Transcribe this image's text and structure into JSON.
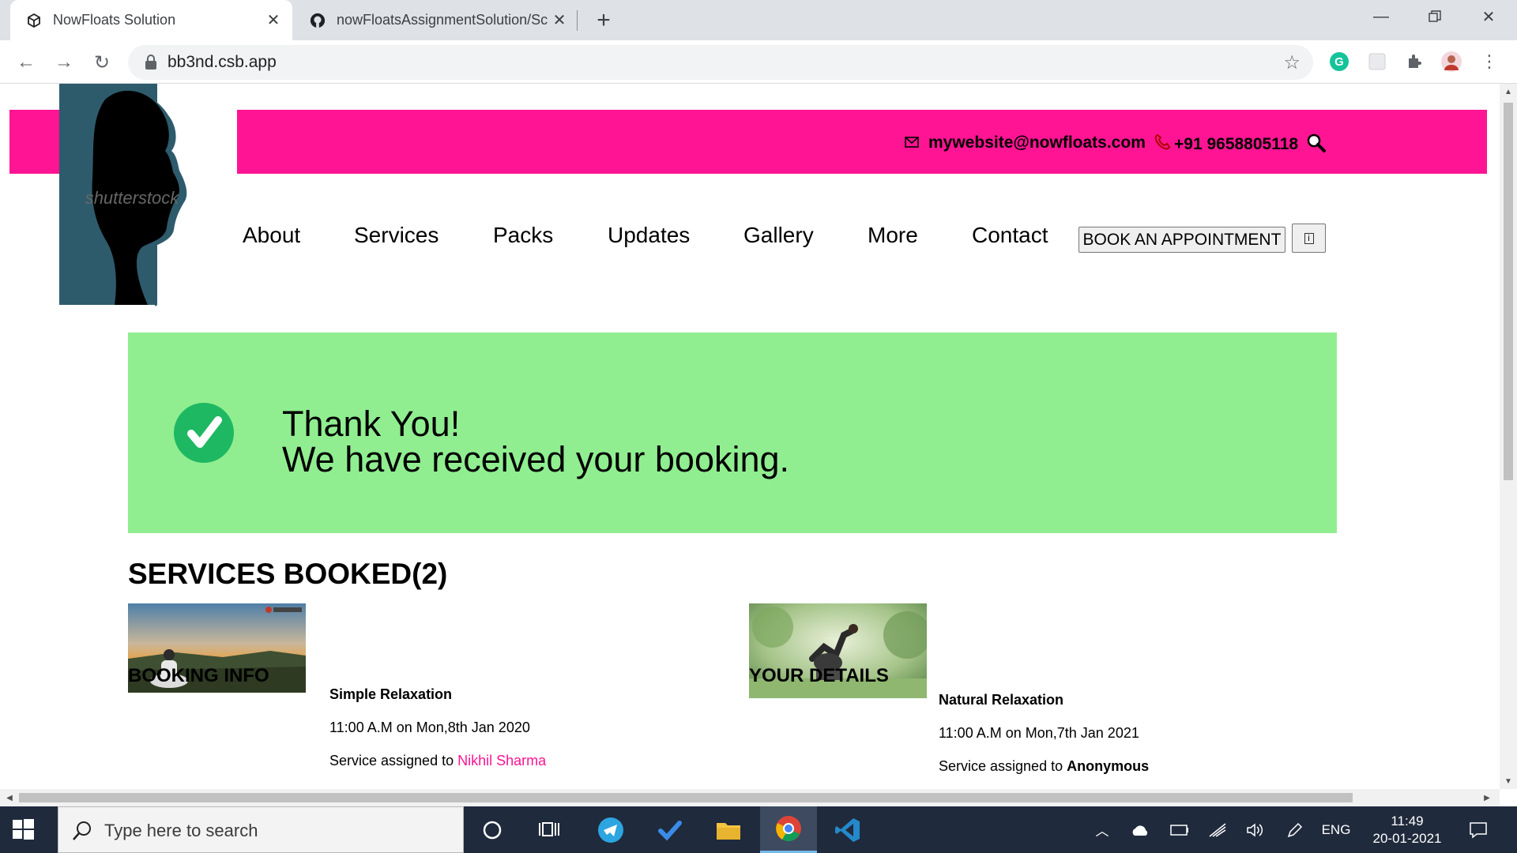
{
  "browser": {
    "tabs": [
      {
        "title": "NowFloats Solution",
        "active": true,
        "favicon": "codesandbox-icon"
      },
      {
        "title": "nowFloatsAssignmentSolution/Sc",
        "active": false,
        "favicon": "github-icon"
      }
    ],
    "url": "bb3nd.csb.app"
  },
  "site": {
    "email": "mywebsite@nowfloats.com",
    "phone": "+91 9658805118",
    "logo_watermark": "shutterstock",
    "nav": [
      "About",
      "Services",
      "Packs",
      "Updates",
      "Gallery",
      "More",
      "Contact"
    ],
    "book_button": "BOOK AN APPOINTMENT",
    "info_button_glyph": "i",
    "accent_color": "#ff1493",
    "success_bg": "#90ee90"
  },
  "confirmation": {
    "line1": "Thank You!",
    "line2": "We have received your booking."
  },
  "services_booked": {
    "title": "SERVICES BOOKED(2)",
    "items": [
      {
        "name": "Simple Relaxation",
        "time": "11:00 A.M on Mon,8th Jan 2020",
        "assigned_prefix": "Service assigned to ",
        "assignee": "Nikhil Sharma"
      },
      {
        "name": "Natural Relaxation",
        "time": "11:00 A.M on Mon,7th Jan 2021",
        "assigned_prefix": "Service assigned to ",
        "assignee": "Anonymous"
      }
    ]
  },
  "sections": {
    "booking_info": "BOOKING INFO",
    "your_details": "YOUR DETAILS"
  },
  "taskbar": {
    "search_placeholder": "Type here to search",
    "language": "ENG",
    "time": "11:49",
    "date": "20-01-2021"
  }
}
